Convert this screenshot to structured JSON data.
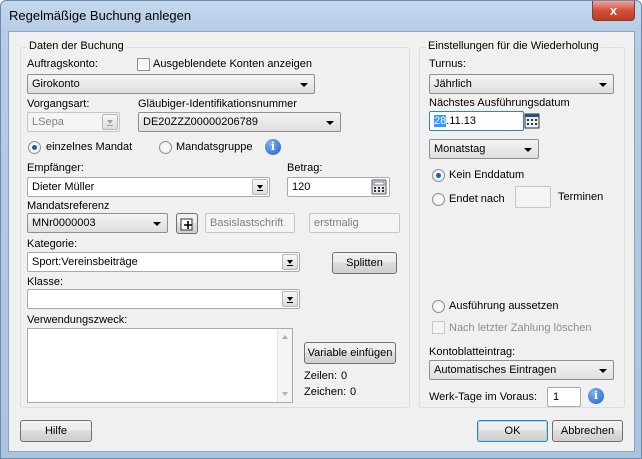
{
  "window": {
    "title": "Regelmäßige Buchung anlegen",
    "close": "x"
  },
  "booking": {
    "group_title": "Daten der Buchung",
    "account_label": "Auftragskonto:",
    "show_hidden_label": "Ausgeblendete Konten anzeigen",
    "account_value": "Girokonto",
    "type_label": "Vorgangsart:",
    "type_value": "LSepa",
    "creditor_label": "Gläubiger-Identifikationsnummer",
    "creditor_value": "DE20ZZZ00000206789",
    "mandate_single": "einzelnes Mandat",
    "mandate_group": "Mandatsgruppe",
    "recipient_label": "Empfänger:",
    "recipient_value": "Dieter Müller",
    "amount_label": "Betrag:",
    "amount_value": "120",
    "mandate_ref_label": "Mandatsreferenz",
    "mandate_ref_value": "MNr0000003",
    "basis_placeholder": "Basislastschrift",
    "first_placeholder": "erstmalig",
    "category_label": "Kategorie:",
    "category_value": "Sport:Vereinsbeiträge",
    "split_button": "Splitten",
    "class_label": "Klasse:",
    "class_value": "",
    "purpose_label": "Verwendungszweck:",
    "insert_variable_button": "Variable einfügen",
    "lines_label": "Zeilen:",
    "lines_value": "0",
    "chars_label": "Zeichen:",
    "chars_value": "0"
  },
  "recurrence": {
    "group_title": "Einstellungen für die Wiederholung",
    "interval_label": "Turnus:",
    "interval_value": "Jährlich",
    "next_date_label": "Nächstes Ausführungsdatum",
    "next_date_day": "28",
    "next_date_rest": ".11.13",
    "day_mode_value": "Monatstag",
    "no_end_label": "Kein Enddatum",
    "ends_after_label": "Endet nach",
    "ends_after_value": "",
    "terms_label": "Terminen",
    "suspend_label": "Ausführung aussetzen",
    "delete_after_last_label": "Nach letzter Zahlung löschen",
    "statement_label": "Kontoblatteintrag:",
    "statement_value": "Automatisches Eintragen",
    "workdays_label": "Werk-Tage im Voraus:",
    "workdays_value": "1"
  },
  "footer": {
    "help": "Hilfe",
    "ok": "OK",
    "cancel": "Abbrechen"
  }
}
